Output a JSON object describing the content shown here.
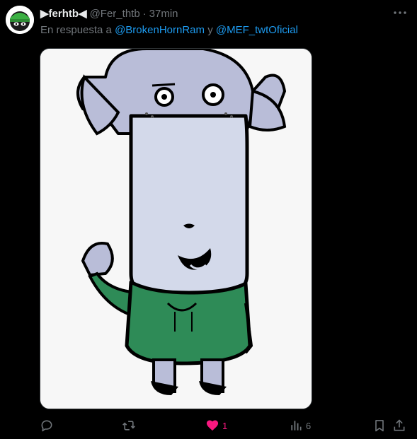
{
  "tweet": {
    "display_name": "▶ferhtb◀",
    "handle": "@Fer_thtb",
    "separator": "·",
    "time": "37min",
    "reply_prefix": "En respuesta a",
    "mentions": [
      "@BrokenHornRam",
      "@MEF_twtOficial"
    ],
    "mention_joiner": "y"
  },
  "actions": {
    "reply_icon": "reply-icon",
    "retweet_icon": "retweet-icon",
    "like_icon": "heart-icon",
    "like_count": "1",
    "views_icon": "views-icon",
    "views_count": "6",
    "bookmark_icon": "bookmark-icon",
    "share_icon": "share-icon"
  },
  "colors": {
    "background": "#000000",
    "mention": "#1d9bf0",
    "muted": "#71767b",
    "like": "#f91880"
  }
}
